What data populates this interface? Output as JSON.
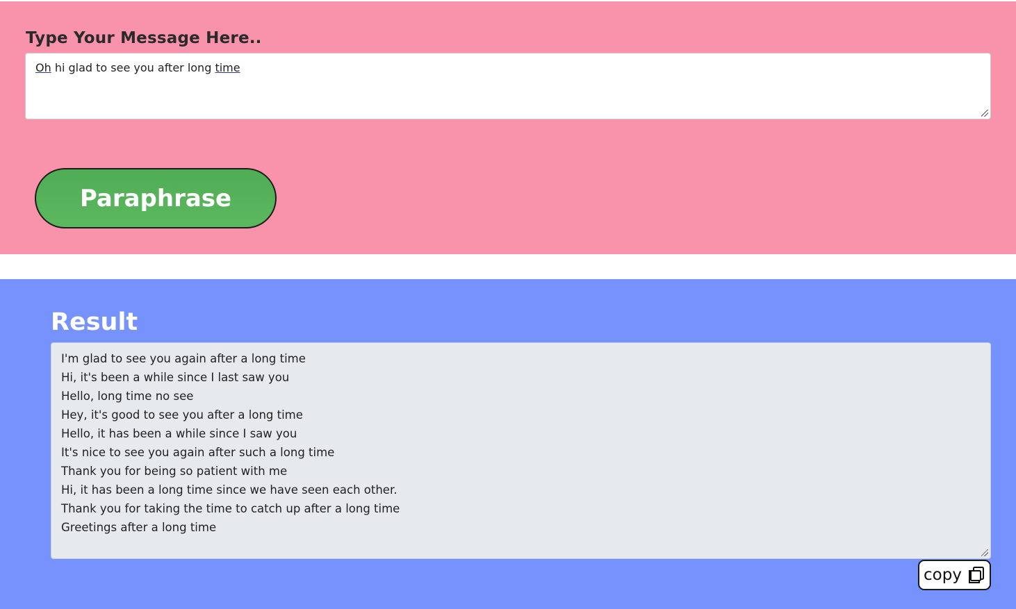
{
  "input_section": {
    "label": "Type Your Message Here..",
    "message_value": {
      "word1": "Oh",
      "middle": " hi glad to see you after long ",
      "word2": "time"
    },
    "submit_label": "Paraphrase"
  },
  "result_section": {
    "title": "Result",
    "lines": [
      "I'm glad to see you again after a long time",
      "Hi, it's been a while since I last saw you",
      "Hello, long time no see",
      "Hey, it's good to see you after a long time",
      "Hello, it has been a while since I saw you",
      "It's nice to see you again after such a long time",
      "Thank you for being so patient with me",
      "Hi, it has been a long time since we have seen each other.",
      "Thank you for taking the time to catch up after a long time",
      "Greetings after a long time"
    ],
    "copy_label": "copy",
    "copy_icon": "copy-icon"
  },
  "colors": {
    "top_background": "#f993ac",
    "bottom_background": "#7592fd",
    "button_green": "#5cb85f",
    "result_box": "#e7eaed"
  }
}
